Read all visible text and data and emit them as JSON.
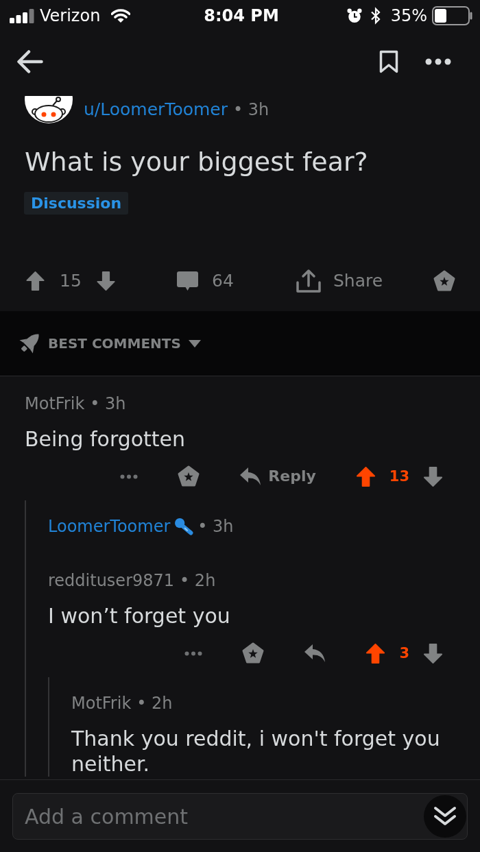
{
  "status_bar": {
    "carrier": "Verizon",
    "time": "8:04 PM",
    "battery": "35%"
  },
  "post": {
    "author": "u/LoomerToomer",
    "age": "• 3h",
    "title": "What is your biggest fear?",
    "flair": "Discussion",
    "score": "15",
    "upvoted": false,
    "comment_count": "64",
    "share_label": "Share"
  },
  "sort": {
    "label": "BEST COMMENTS"
  },
  "comments": [
    {
      "author": "MotFrik",
      "op": false,
      "age": "• 3h",
      "body": "Being forgotten",
      "score": "13",
      "upvoted": true,
      "reply_label": "Reply",
      "children": [
        {
          "author": "LoomerToomer",
          "op": true,
          "age": "• 3h"
        },
        {
          "author": "reddituser9871",
          "op": false,
          "age": "• 2h",
          "body": "I won’t forget you",
          "score": "3",
          "upvoted": true,
          "children": [
            {
              "author": "MotFrik",
              "op": false,
              "age": "• 2h",
              "body": "Thank you reddit, i won't forget you neither."
            }
          ]
        }
      ]
    }
  ],
  "composer": {
    "placeholder": "Add a comment"
  }
}
